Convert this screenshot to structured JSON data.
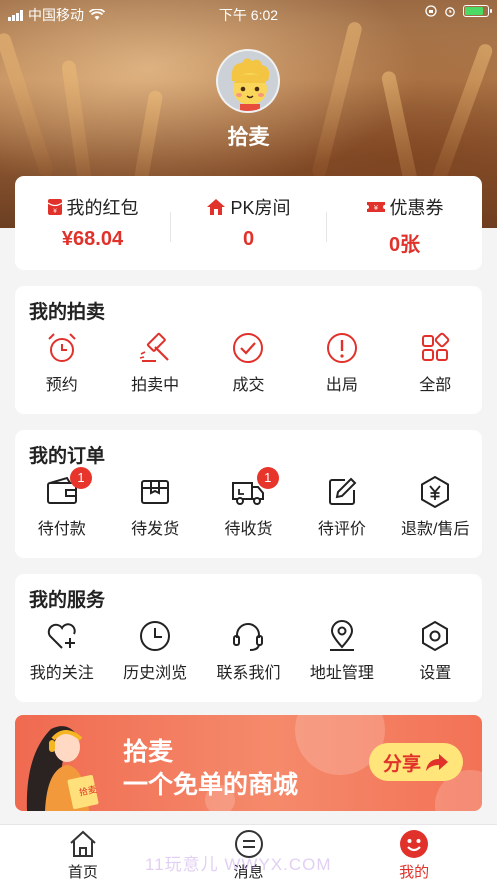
{
  "status_bar": {
    "carrier": "中国移动",
    "time": "下午 6:02"
  },
  "profile": {
    "username": "拾麦"
  },
  "stats": [
    {
      "label": "我的红包",
      "value": "¥68.04",
      "icon": "red-envelope-icon"
    },
    {
      "label": "PK房间",
      "value": "0",
      "icon": "house-icon"
    },
    {
      "label": "优惠券",
      "value": "0张",
      "icon": "coupon-icon"
    }
  ],
  "auctions": {
    "title": "我的拍卖",
    "items": [
      {
        "label": "预约",
        "icon": "alarm-clock-icon"
      },
      {
        "label": "拍卖中",
        "icon": "gavel-icon"
      },
      {
        "label": "成交",
        "icon": "check-circle-icon"
      },
      {
        "label": "出局",
        "icon": "exclamation-circle-icon"
      },
      {
        "label": "全部",
        "icon": "grid-icon"
      }
    ]
  },
  "orders": {
    "title": "我的订单",
    "items": [
      {
        "label": "待付款",
        "icon": "wallet-icon",
        "badge": "1"
      },
      {
        "label": "待发货",
        "icon": "package-icon",
        "badge": ""
      },
      {
        "label": "待收货",
        "icon": "truck-icon",
        "badge": "1"
      },
      {
        "label": "待评价",
        "icon": "edit-icon",
        "badge": ""
      },
      {
        "label": "退款/售后",
        "icon": "yen-hexagon-icon",
        "badge": ""
      }
    ]
  },
  "services": {
    "title": "我的服务",
    "items": [
      {
        "label": "我的关注",
        "icon": "heart-plus-icon"
      },
      {
        "label": "历史浏览",
        "icon": "clock-icon"
      },
      {
        "label": "联系我们",
        "icon": "headset-icon"
      },
      {
        "label": "地址管理",
        "icon": "location-pin-icon"
      },
      {
        "label": "设置",
        "icon": "settings-hexagon-icon"
      }
    ]
  },
  "banner": {
    "line1": "拾麦",
    "line2": "一个免单的商城",
    "share_label": "分享",
    "book_text": "拾麦"
  },
  "tabbar": [
    {
      "label": "首页",
      "icon": "home-icon",
      "active": false
    },
    {
      "label": "消息",
      "icon": "message-icon",
      "active": false
    },
    {
      "label": "我的",
      "icon": "smiley-icon",
      "active": true
    }
  ],
  "watermark": "11玩意儿 WWYX.COM",
  "colors": {
    "accent": "#e0322b",
    "badge": "#e8352c",
    "banner": "#f06a50",
    "share_button": "#ffe57a"
  }
}
